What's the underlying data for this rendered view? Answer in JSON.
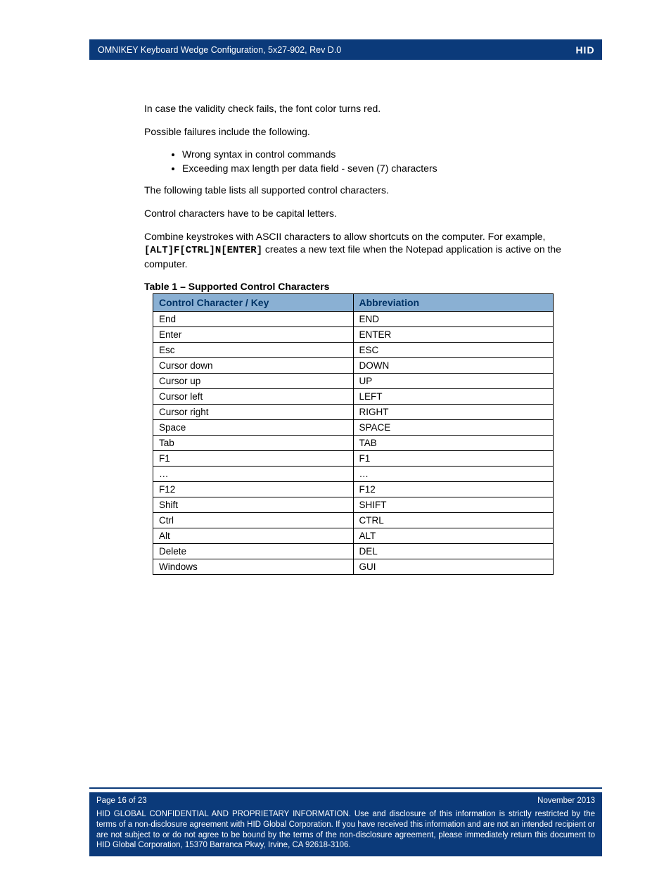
{
  "header": {
    "title": "OMNIKEY Keyboard Wedge Configuration, 5x27-902, Rev D.0",
    "logo_text": "HID"
  },
  "body": {
    "p1": "In case the validity check fails, the font color turns red.",
    "p2": "Possible failures include the following.",
    "bullets": [
      "Wrong syntax in control commands",
      "Exceeding max length per data field - seven (7) characters"
    ],
    "p3": "The following table lists all supported control characters.",
    "p4": "Control characters have to be capital letters.",
    "p5a": "Combine keystrokes with ASCII characters to allow shortcuts on the computer. For example, ",
    "p5code": "[ALT]F[CTRL]N[ENTER]",
    "p5b": " creates a new text file when the Notepad application is active on the computer.",
    "table_caption": "Table 1 – Supported Control Characters",
    "table": {
      "head": {
        "c1": "Control Character / Key",
        "c2": "Abbreviation"
      },
      "rows": [
        {
          "c1": "End",
          "c2": "END"
        },
        {
          "c1": "Enter",
          "c2": "ENTER"
        },
        {
          "c1": "Esc",
          "c2": "ESC"
        },
        {
          "c1": "Cursor down",
          "c2": "DOWN"
        },
        {
          "c1": "Cursor up",
          "c2": "UP"
        },
        {
          "c1": "Cursor left",
          "c2": "LEFT"
        },
        {
          "c1": "Cursor right",
          "c2": "RIGHT"
        },
        {
          "c1": "Space",
          "c2": "SPACE"
        },
        {
          "c1": "Tab",
          "c2": "TAB"
        },
        {
          "c1": "F1",
          "c2": "F1"
        },
        {
          "c1": "…",
          "c2": "…"
        },
        {
          "c1": "F12",
          "c2": "F12"
        },
        {
          "c1": "Shift",
          "c2": "SHIFT"
        },
        {
          "c1": "Ctrl",
          "c2": "CTRL"
        },
        {
          "c1": "Alt",
          "c2": "ALT"
        },
        {
          "c1": "Delete",
          "c2": "DEL"
        },
        {
          "c1": "Windows",
          "c2": "GUI"
        }
      ]
    }
  },
  "footer": {
    "page": "Page 16 of 23",
    "date": "November 2013",
    "notice": "HID GLOBAL CONFIDENTIAL AND PROPRIETARY INFORMATION.  Use and disclosure of this information is strictly restricted by the terms of a non-disclosure agreement with HID Global Corporation.  If you have received this information and are not an intended recipient or are not subject to or do not agree to be bound by the terms of the non-disclosure agreement, please immediately return this document to HID Global Corporation, 15370 Barranca Pkwy, Irvine, CA 92618-3106."
  }
}
